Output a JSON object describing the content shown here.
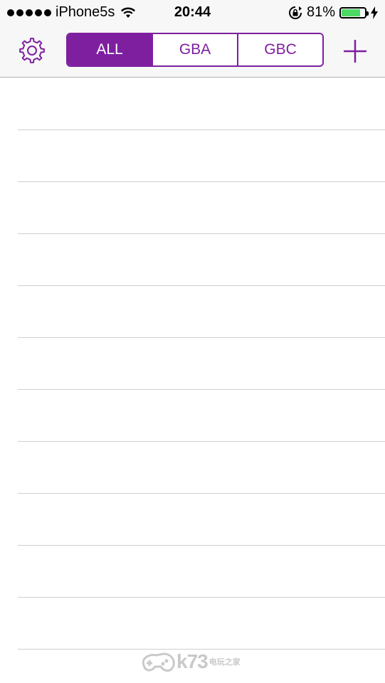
{
  "status_bar": {
    "carrier": "iPhone5s",
    "time": "20:44",
    "battery_percent_label": "81%",
    "battery_level": 0.81
  },
  "nav": {
    "tabs": [
      {
        "label": "ALL",
        "active": true
      },
      {
        "label": "GBA",
        "active": false
      },
      {
        "label": "GBC",
        "active": false
      }
    ]
  },
  "list": {
    "row_count": 11
  },
  "watermark": {
    "brand": "k73",
    "sub": "电玩之家"
  },
  "colors": {
    "accent": "#7e1fa0",
    "battery": "#4cd964"
  },
  "icons": [
    "settings-gear-icon",
    "add-plus-icon",
    "wifi-icon",
    "rotation-lock-icon",
    "charging-bolt-icon"
  ]
}
